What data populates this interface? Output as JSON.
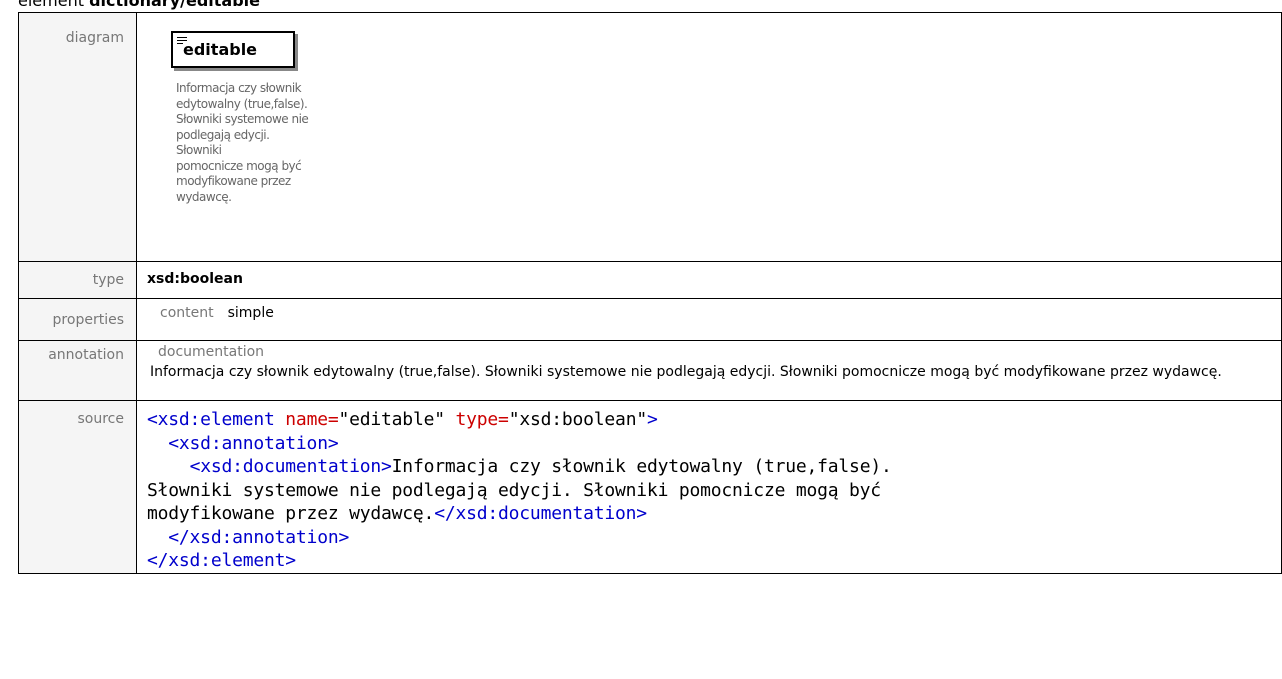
{
  "heading": {
    "prefix": "element ",
    "name": "dictionary/editable"
  },
  "rows": {
    "diagram": {
      "label": "diagram",
      "box_title": "editable",
      "doc_text": "Informacja czy słownik\nedytowalny (true,false).\nSłowniki systemowe nie\npodlegają edycji. Słowniki\npomocnicze mogą być\nmodyfikowane przez\nwydawcę."
    },
    "type": {
      "label": "type",
      "value": "xsd:boolean"
    },
    "properties": {
      "label": "properties",
      "key": "content",
      "value": "simple"
    },
    "annotation": {
      "label": "annotation",
      "key": "documentation",
      "text": "Informacja czy słownik edytowalny (true,false). Słowniki systemowe nie podlegają edycji. Słowniki pomocnicze mogą być modyfikowane przez wydawcę."
    },
    "source": {
      "label": "source",
      "line1_open": "<xsd:element",
      "line1_attr1": " name=",
      "line1_val1": "\"editable\"",
      "line1_attr2": " type=",
      "line1_val2": "\"xsd:boolean\"",
      "line1_close": ">",
      "line2": "  <xsd:annotation>",
      "line3_indent": "    ",
      "line3_open": "<xsd:documentation>",
      "doc_text": "Informacja czy słownik edytowalny (true,false).\nSłowniki systemowe nie podlegają edycji. Słowniki pomocnicze mogą być\nmodyfikowane przez wydawcę.",
      "doc_close": "</xsd:documentation>",
      "line4": "  </xsd:annotation>",
      "line5": "</xsd:element>"
    }
  },
  "colors": {
    "tag": "#0000cc",
    "attribute": "#cc0000",
    "label": "#777777",
    "label_bg": "#f5f5f5"
  }
}
